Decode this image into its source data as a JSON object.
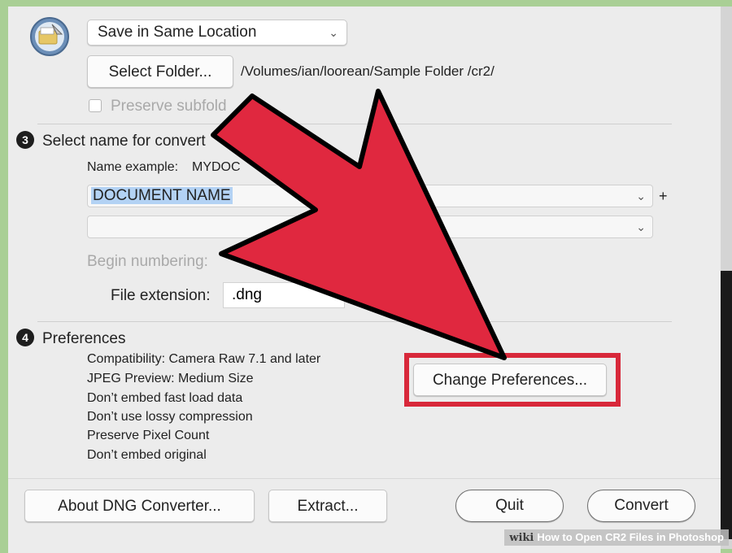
{
  "output": {
    "location_popup": "Save in Same Location",
    "select_folder_label": "Select Folder...",
    "folder_path": "/Volumes/ian/loorean/Sample Folder /cr2/",
    "preserve_subfolders_label": "Preserve subfold"
  },
  "naming": {
    "step_number": "3",
    "title": "Select name for convert",
    "example_label": "Name example:",
    "example_value": "MYDOC",
    "name_field_1": "DOCUMENT NAME",
    "name_field_2": "",
    "plus_label": "+",
    "begin_numbering_label": "Begin numbering:",
    "file_extension_label": "File extension:",
    "file_extension_value": ".dng"
  },
  "preferences": {
    "step_number": "4",
    "title": "Preferences",
    "lines": [
      "Compatibility: Camera Raw 7.1 and later",
      "JPEG Preview: Medium Size",
      "Don’t embed fast load data",
      "Don’t use lossy compression",
      "Preserve Pixel Count",
      "Don’t embed original"
    ],
    "change_button": "Change Preferences..."
  },
  "footer": {
    "about_button": "About DNG Converter...",
    "extract_button": "Extract...",
    "quit_button": "Quit",
    "convert_button": "Convert"
  },
  "annotation": {
    "arrow_color": "#e0283f",
    "highlight_color": "#d8283a"
  },
  "watermark": {
    "brand": "wiki",
    "caption": "How to Open CR2 Files in Photoshop"
  }
}
